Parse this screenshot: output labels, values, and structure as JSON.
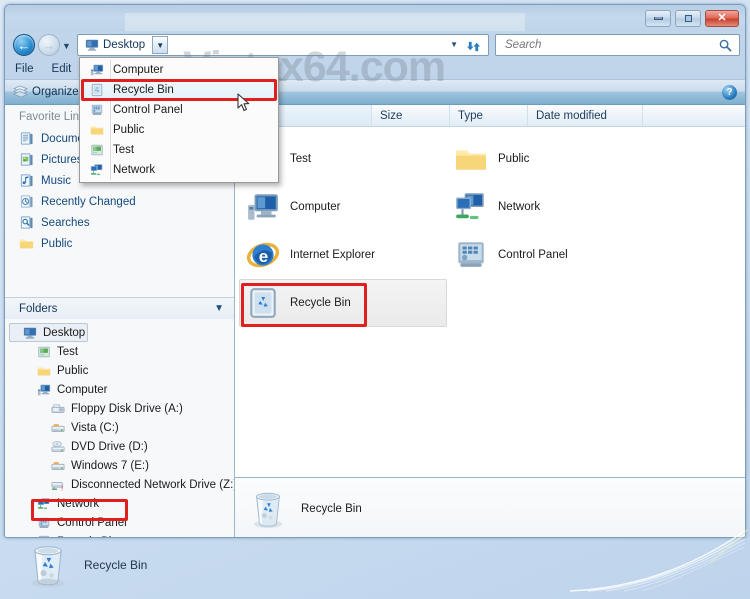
{
  "window": {
    "minimize_label": "Minimize",
    "maximize_label": "Maximize",
    "close_label": "Close"
  },
  "watermark": "Vistax64.com",
  "navbar": {
    "back_label": "Back",
    "forward_label": "Forward",
    "history_label": "Recent pages",
    "crumb": "Desktop",
    "crumb_icon": "desktop-icon",
    "dropdown_label": "Previous locations",
    "refresh_label": "Refresh",
    "search_placeholder": "Search",
    "search_value": "",
    "search_icon": "search-icon"
  },
  "menubar": {
    "items": [
      {
        "label": "File",
        "name": "menu-file"
      },
      {
        "label": "Edit",
        "name": "menu-edit"
      }
    ]
  },
  "toolbar": {
    "organize_label": "Organize",
    "organize_icon": "organize-icon",
    "help_label": "?",
    "help_icon": "help-icon"
  },
  "crumb_popup": {
    "items": [
      {
        "label": "Computer",
        "icon": "computer-icon",
        "hovered": false
      },
      {
        "label": "Recycle Bin",
        "icon": "recyclebin-icon",
        "hovered": true
      },
      {
        "label": "Control Panel",
        "icon": "controlpanel-icon",
        "hovered": false
      },
      {
        "label": "Public",
        "icon": "folder-icon",
        "hovered": false
      },
      {
        "label": "Test",
        "icon": "testfolder-icon",
        "hovered": false
      },
      {
        "label": "Network",
        "icon": "network-icon",
        "hovered": false
      }
    ]
  },
  "navpane": {
    "favorites_header": "Favorite Links",
    "favorites": [
      {
        "label": "Documents",
        "icon": "documents-icon"
      },
      {
        "label": "Pictures",
        "icon": "pictures-icon"
      },
      {
        "label": "Music",
        "icon": "music-icon"
      },
      {
        "label": "Recently Changed",
        "icon": "recent-icon"
      },
      {
        "label": "Searches",
        "icon": "searches-icon"
      },
      {
        "label": "Public",
        "icon": "folder-icon"
      }
    ],
    "folders_header": "Folders",
    "folders_chevron": "chevron-down-icon",
    "tree": [
      {
        "label": "Desktop",
        "icon": "desktop-icon",
        "indent": 0,
        "selected": true
      },
      {
        "label": "Test",
        "icon": "testfolder-icon",
        "indent": 1,
        "selected": false
      },
      {
        "label": "Public",
        "icon": "folder-icon",
        "indent": 1,
        "selected": false
      },
      {
        "label": "Computer",
        "icon": "computer-icon",
        "indent": 1,
        "selected": false
      },
      {
        "label": "Floppy Disk Drive (A:)",
        "icon": "floppy-icon",
        "indent": 2,
        "selected": false
      },
      {
        "label": "Vista (C:)",
        "icon": "harddrive-icon",
        "indent": 2,
        "selected": false
      },
      {
        "label": "DVD Drive (D:)",
        "icon": "dvd-icon",
        "indent": 2,
        "selected": false
      },
      {
        "label": "Windows 7 (E:)",
        "icon": "harddrive-icon",
        "indent": 2,
        "selected": false
      },
      {
        "label": "Disconnected Network Drive (Z:)",
        "icon": "netdrive-icon",
        "indent": 2,
        "selected": false
      },
      {
        "label": "Network",
        "icon": "network-icon",
        "indent": 1,
        "selected": false
      },
      {
        "label": "Control Panel",
        "icon": "controlpanel-icon",
        "indent": 1,
        "selected": false
      },
      {
        "label": "Recycle Bin",
        "icon": "recyclebin-icon",
        "indent": 1,
        "selected": false
      }
    ]
  },
  "content": {
    "columns": [
      {
        "label": "",
        "name": "column-name"
      },
      {
        "label": "Size",
        "name": "column-size"
      },
      {
        "label": "Type",
        "name": "column-type"
      },
      {
        "label": "Date modified",
        "name": "column-date-modified"
      }
    ],
    "items": [
      {
        "label": "Test",
        "icon": "testfolder-icon",
        "selected": false
      },
      {
        "label": "Public",
        "icon": "folder-icon",
        "selected": false
      },
      {
        "label": "Computer",
        "icon": "computer-icon",
        "selected": false
      },
      {
        "label": "Network",
        "icon": "network-icon",
        "selected": false
      },
      {
        "label": "Internet Explorer",
        "icon": "ie-icon",
        "selected": false
      },
      {
        "label": "Control Panel",
        "icon": "controlpanel-icon",
        "selected": false
      },
      {
        "label": "Recycle Bin",
        "icon": "recyclebin-icon",
        "selected": true
      }
    ]
  },
  "details": {
    "label": "Recycle Bin",
    "icon": "recyclebin-icon"
  },
  "desktop": {
    "icon_label": "Recycle Bin",
    "icon": "recyclebin-icon"
  },
  "annotations": {
    "color": "#e01f1f",
    "boxes": [
      {
        "name": "annot-popup-recyclebin",
        "target": "Recycle Bin"
      },
      {
        "name": "annot-tree-recyclebin",
        "target": "Recycle Bin"
      },
      {
        "name": "annot-grid-recyclebin",
        "target": "Recycle Bin"
      }
    ]
  }
}
